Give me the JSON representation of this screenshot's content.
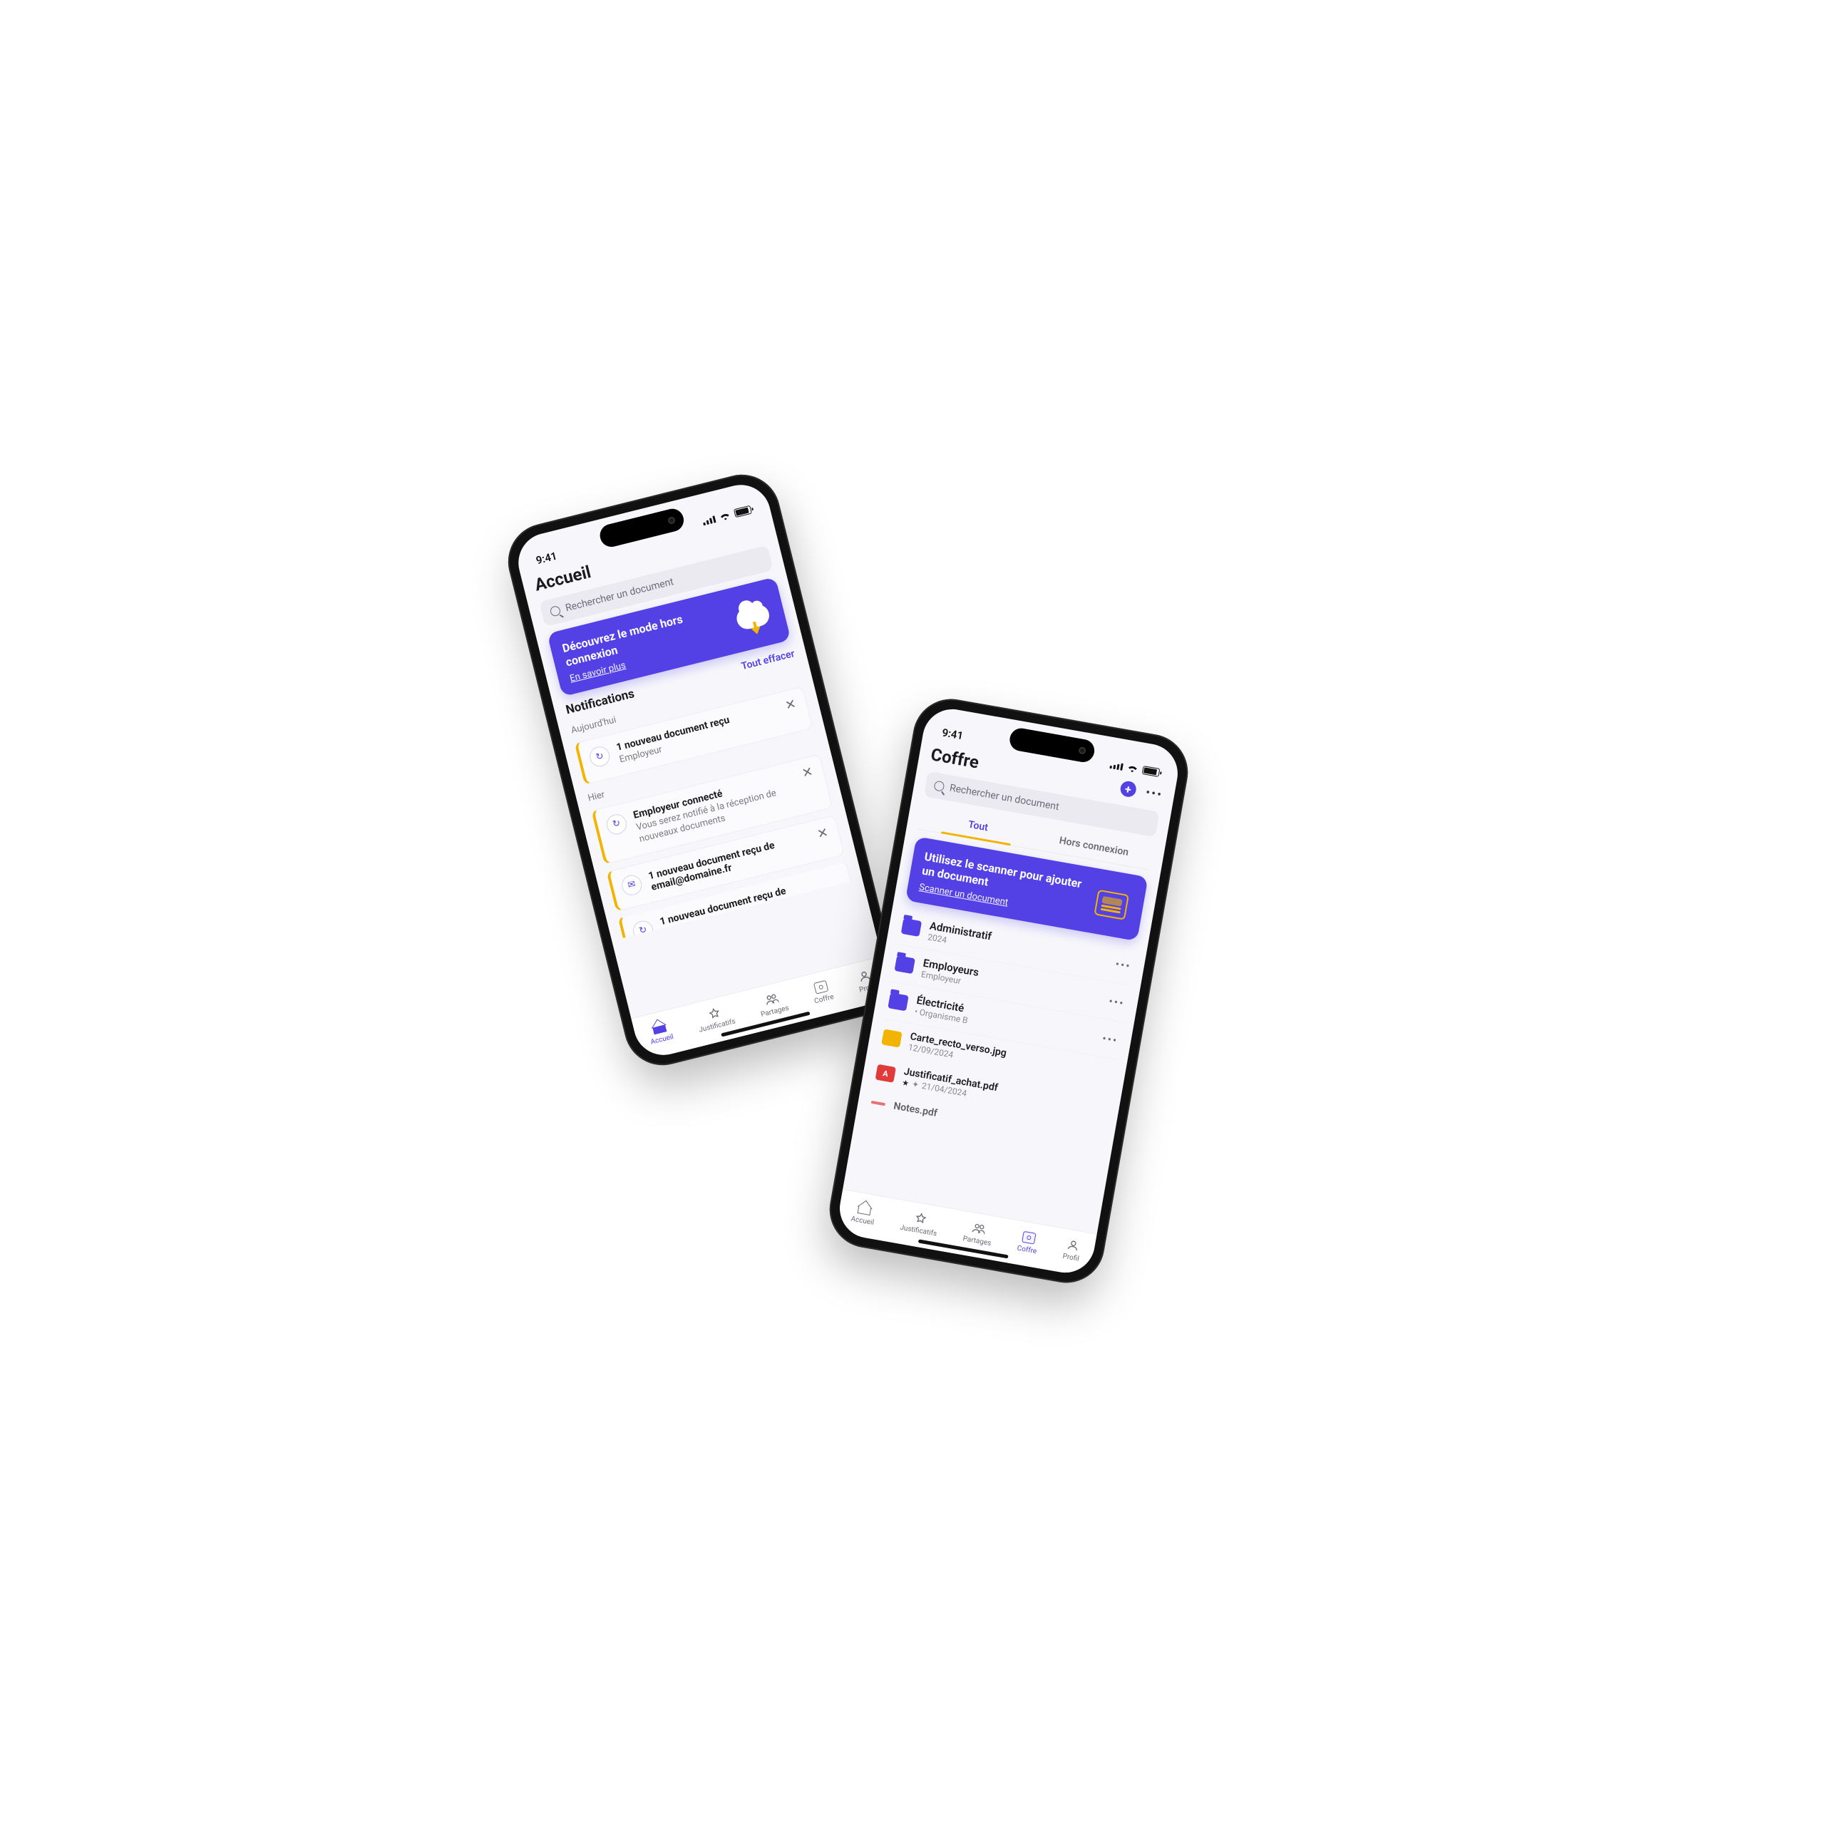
{
  "colors": {
    "accent": "#5341e6",
    "highlight": "#f2b400"
  },
  "status": {
    "time": "9:41"
  },
  "home": {
    "title": "Accueil",
    "search_placeholder": "Rechercher un document",
    "banner": {
      "title": "Découvrez le mode hors connexion",
      "link": "En savoir plus"
    },
    "notifications_title": "Notifications",
    "clear_all": "Tout effacer",
    "groups": [
      {
        "label": "Aujourd'hui",
        "items": [
          {
            "icon": "link-icon",
            "title": "1 nouveau document reçu",
            "subtitle": "Employeur"
          }
        ]
      },
      {
        "label": "Hier",
        "items": [
          {
            "icon": "link-icon",
            "title": "Employeur connecté",
            "subtitle": "Vous serez notifié à la réception de nouveaux documents"
          },
          {
            "icon": "mail-icon",
            "title": "1 nouveau document reçu de email@domaine.fr",
            "subtitle": ""
          },
          {
            "icon": "link-icon",
            "title": "1 nouveau document reçu de",
            "subtitle": ""
          }
        ]
      }
    ]
  },
  "coffre": {
    "title": "Coffre",
    "search_placeholder": "Rechercher un document",
    "tabs": {
      "all": "Tout",
      "offline": "Hors connexion"
    },
    "banner": {
      "title": "Utilisez le scanner pour ajouter un document",
      "link": "Scanner un document"
    },
    "folders": [
      {
        "title": "Administratif",
        "subtitle": "2024"
      },
      {
        "title": "Employeurs",
        "subtitle": "Employeur"
      },
      {
        "title": "Électricité",
        "subtitle": "• Organisme B"
      }
    ],
    "files": [
      {
        "kind": "img",
        "title": "Carte_recto_verso.jpg",
        "subtitle": "12/09/2024"
      },
      {
        "kind": "pdf",
        "title": "Justificatif_achat.pdf",
        "subtitle": "21/04/2024",
        "starred": true
      },
      {
        "kind": "pdf",
        "title": "Notes.pdf",
        "subtitle": ""
      }
    ]
  },
  "tabs": {
    "home": "Accueil",
    "docs": "Justificatifs",
    "share": "Partages",
    "safe": "Coffre",
    "profile": "Profil"
  }
}
